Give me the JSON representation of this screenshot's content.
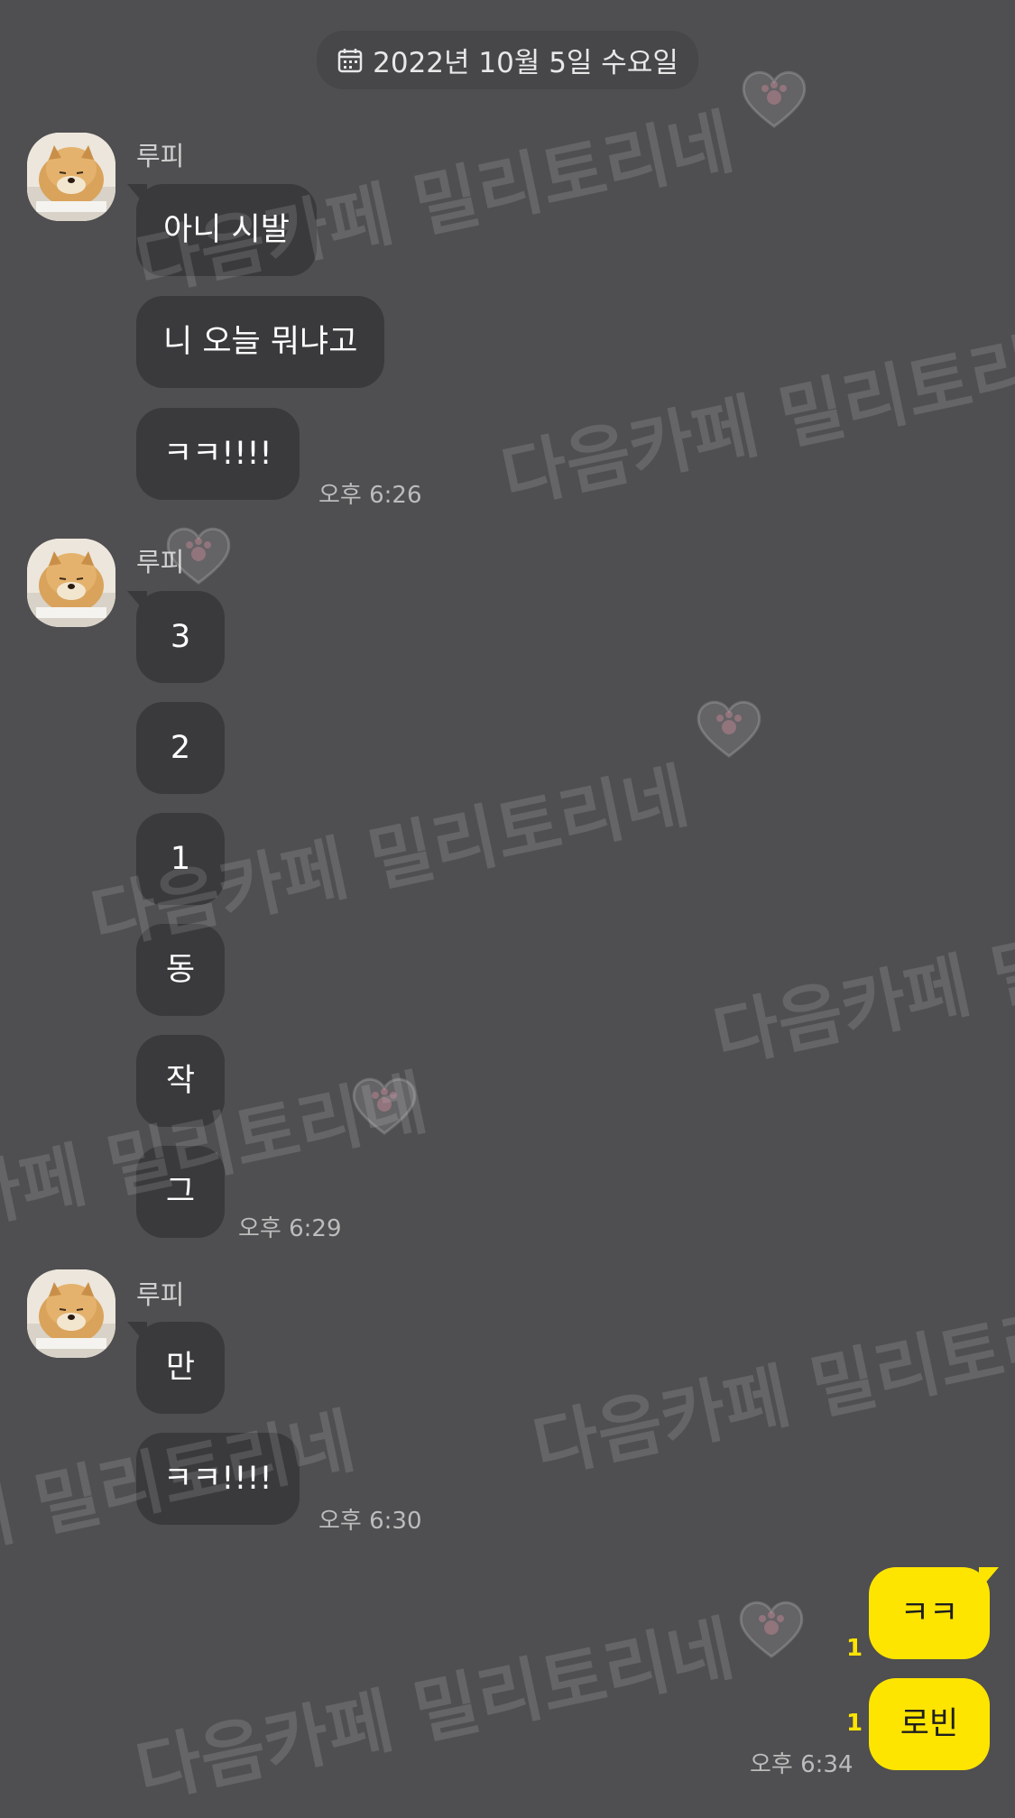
{
  "date_header": {
    "text": "2022년 10월 5일 수요일",
    "icon": "calendar-icon"
  },
  "groups": [
    {
      "sender": "루피",
      "messages": [
        "아니 시발",
        "니 오늘 뭐냐고",
        "ㅋㅋ!!!!"
      ],
      "time": "오후 6:26"
    },
    {
      "sender": "루피",
      "messages": [
        "3",
        "2",
        "1",
        "동",
        "작",
        "그"
      ],
      "time": "오후 6:29"
    },
    {
      "sender": "루피",
      "messages": [
        "만",
        "ㅋㅋ!!!!"
      ],
      "time": "오후 6:30"
    }
  ],
  "my_messages": {
    "messages": [
      "ㅋㅋ",
      "로빈"
    ],
    "unread": [
      "1",
      "1"
    ],
    "time": "오후 6:34"
  },
  "watermark": {
    "text": "다음카페 밀리토리네"
  },
  "colors": {
    "background": "#4f4e50",
    "bubble_other": "#3a393b",
    "bubble_mine": "#fee500",
    "unread": "#fee500"
  }
}
